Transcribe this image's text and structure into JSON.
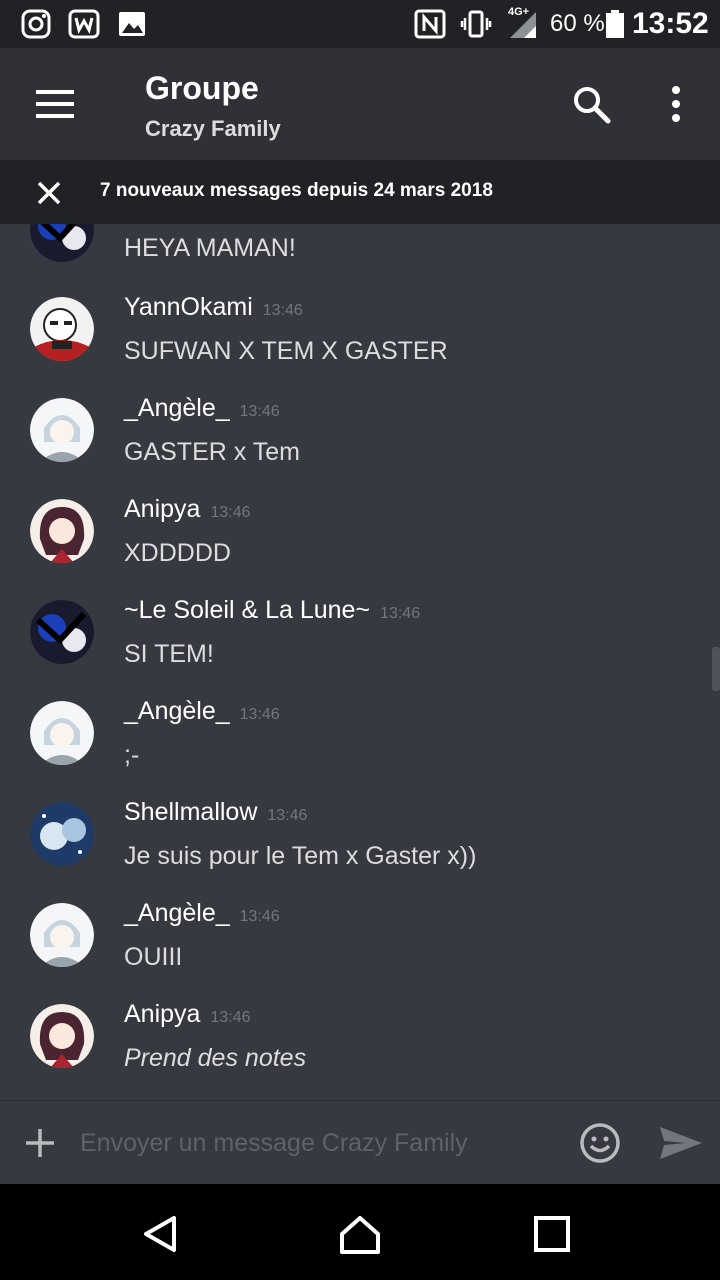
{
  "status_bar": {
    "battery_percent": "60 %",
    "time": "13:52",
    "network": "4G+"
  },
  "header": {
    "title": "Groupe",
    "subtitle": "Crazy Family"
  },
  "new_messages_bar": {
    "text": "7 nouveaux messages depuis 24 mars 2018"
  },
  "messages": [
    {
      "author": "",
      "time": "",
      "content": "HEYA MAMAN!",
      "avatar": "soleil-lune-avatar"
    },
    {
      "author": "YannOkami",
      "time": "13:46",
      "content": "SUFWAN  X TEM X GASTER",
      "avatar": "yannokami-avatar"
    },
    {
      "author": "_Angèle_",
      "time": "13:46",
      "content": "GASTER x Tem",
      "avatar": "angele-avatar"
    },
    {
      "author": "Anipya",
      "time": "13:46",
      "content": "XDDDDD",
      "avatar": "anipya-avatar"
    },
    {
      "author": "~Le Soleil & La Lune~",
      "time": "13:46",
      "content": "SI TEM!",
      "avatar": "soleil-lune-avatar"
    },
    {
      "author": "_Angèle_",
      "time": "13:46",
      "content": ";-",
      "avatar": "angele-avatar"
    },
    {
      "author": "Shellmallow",
      "time": "13:46",
      "content": "Je suis pour le Tem x Gaster x))",
      "avatar": "shellmallow-avatar"
    },
    {
      "author": "_Angèle_",
      "time": "13:46",
      "content": "OUIII",
      "avatar": "angele-avatar"
    },
    {
      "author": "Anipya",
      "time": "13:46",
      "content": "Prend des notes",
      "avatar": "anipya-avatar"
    }
  ],
  "composer": {
    "placeholder": "Envoyer un message Crazy Family"
  },
  "colors": {
    "background": "#36393f",
    "header": "#2f3136",
    "status_bar": "#202225",
    "text": "#dcddde",
    "timestamp": "#72767d"
  }
}
